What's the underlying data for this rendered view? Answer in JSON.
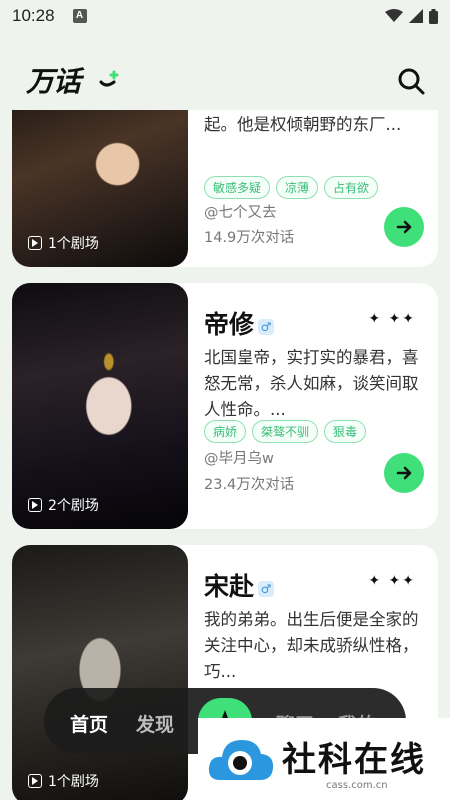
{
  "status_bar": {
    "time": "10:28",
    "notif_letter": "A"
  },
  "header": {
    "logo_text": "万话"
  },
  "cards": [
    {
      "name": "",
      "desc_visible": "官，一头黑色长发用发带束起。他是权倾朝野的东厂...",
      "tags": [
        "敏感多疑",
        "凉薄",
        "占有欲"
      ],
      "author": "@七个又去",
      "stats": "14.9万次对话",
      "episodes": "1个剧场"
    },
    {
      "name": "帝修",
      "gender": "♂",
      "desc_visible": "北国皇帝，实打实的暴君，喜怒无常，杀人如麻，谈笑间取人性命。...",
      "tags": [
        "病娇",
        "桀骜不驯",
        "狠毒"
      ],
      "author": "@毕月乌w",
      "stats": "23.4万次对话",
      "episodes": "2个剧场"
    },
    {
      "name": "宋赴",
      "gender": "♂",
      "desc_visible": "我的弟弟。出生后便是全家的关注中心，却未成骄纵性格，巧...",
      "episodes": "1个剧场"
    }
  ],
  "nav": {
    "home": "首页",
    "discover": "发现",
    "third": "聊天",
    "mine": "我的"
  },
  "watermark": {
    "text": "社科在线",
    "sub": "cass.com.cn"
  },
  "colors": {
    "accent": "#3fe07a",
    "tag": "#3bbd78",
    "background": "#eef3ee"
  }
}
